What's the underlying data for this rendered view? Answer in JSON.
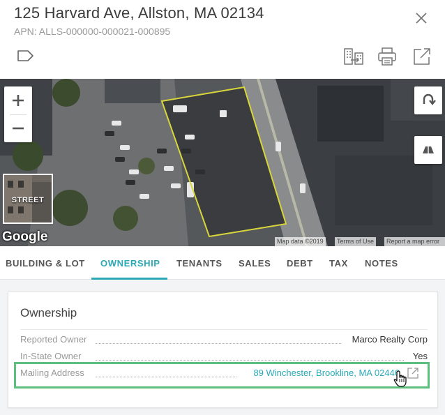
{
  "header": {
    "title": "125 Harvard Ave, Allston, MA 02134",
    "apn": "APN: ALLS-000000-000021-000895"
  },
  "icons": {
    "close": "close-icon",
    "tag": "tag-icon",
    "compare": "compare-buildings-icon",
    "print": "printer-icon",
    "open": "external-link-icon"
  },
  "map": {
    "street_label": "STREET",
    "google_logo": "Google",
    "attribution": {
      "map_data": "Map data ©2019",
      "terms": "Terms of Use",
      "report": "Report a map error"
    }
  },
  "tabs": [
    {
      "label": "BUILDING & LOT",
      "active": false
    },
    {
      "label": "OWNERSHIP",
      "active": true
    },
    {
      "label": "TENANTS",
      "active": false
    },
    {
      "label": "SALES",
      "active": false
    },
    {
      "label": "DEBT",
      "active": false
    },
    {
      "label": "TAX",
      "active": false
    },
    {
      "label": "NOTES",
      "active": false
    }
  ],
  "ownership": {
    "title": "Ownership",
    "rows": [
      {
        "label": "Reported Owner",
        "value": "Marco Realty Corp"
      },
      {
        "label": "In-State Owner",
        "value": "Yes"
      },
      {
        "label": "Mailing Address",
        "value": "89 Winchester, Brookline, MA 02446"
      }
    ]
  },
  "colors": {
    "accent": "#2aa9b5",
    "highlight": "#5cbf7b",
    "parcel_outline": "#d8d63a"
  }
}
